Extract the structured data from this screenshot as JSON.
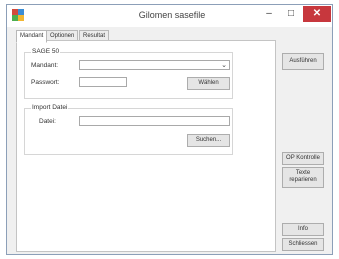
{
  "window": {
    "title": "Gilomen sasefile",
    "min_glyph": "–",
    "max_glyph": "□",
    "close_glyph": "✕",
    "icon": "app-icon"
  },
  "tabs": [
    {
      "label": "Mandant",
      "active": true
    },
    {
      "label": "Optionen",
      "active": false
    },
    {
      "label": "Resultat",
      "active": false
    }
  ],
  "sage_group": {
    "title": "SAGE 50",
    "mandant_label": "Mandant:",
    "mandant_value": "",
    "passwort_label": "Passwort:",
    "passwort_value": "",
    "waehlen_button": "Wählen"
  },
  "import_group": {
    "title": "Import Datei",
    "datei_label": "Datei:",
    "datei_value": "",
    "suchen_button": "Suchen..."
  },
  "side_buttons": {
    "ausfuehren": "Ausführen",
    "op_kontrolle": "OP Kontrolle",
    "texte_line1": "Texte",
    "texte_line2": "reparieren",
    "info": "Info",
    "schliessen": "Schliessen"
  }
}
